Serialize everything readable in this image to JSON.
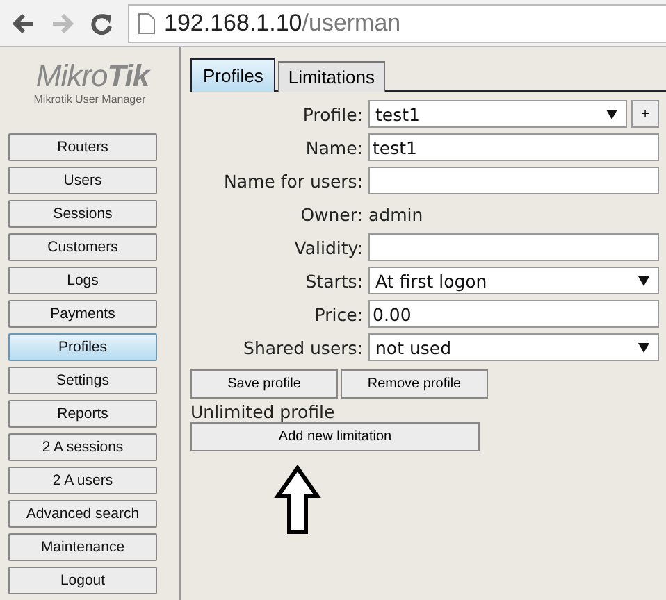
{
  "browser": {
    "url_host": "192.168.1.10",
    "url_path": "/userman"
  },
  "logo": {
    "brand_light": "Mikro",
    "brand_bold": "Tik",
    "subtitle": "Mikrotik User Manager"
  },
  "sidebar": {
    "items": [
      {
        "label": "Routers",
        "selected": false
      },
      {
        "label": "Users",
        "selected": false
      },
      {
        "label": "Sessions",
        "selected": false
      },
      {
        "label": "Customers",
        "selected": false
      },
      {
        "label": "Logs",
        "selected": false
      },
      {
        "label": "Payments",
        "selected": false
      },
      {
        "label": "Profiles",
        "selected": true
      },
      {
        "label": "Settings",
        "selected": false
      },
      {
        "label": "Reports",
        "selected": false
      },
      {
        "label": "2 A sessions",
        "selected": false
      },
      {
        "label": "2 A users",
        "selected": false
      },
      {
        "label": "Advanced search",
        "selected": false
      },
      {
        "label": "Maintenance",
        "selected": false
      },
      {
        "label": "Logout",
        "selected": false
      }
    ]
  },
  "tabs": [
    {
      "label": "Profiles",
      "selected": true
    },
    {
      "label": "Limitations",
      "selected": false
    }
  ],
  "form": [
    {
      "kind": "select",
      "label": "Profile:",
      "value": "test1",
      "add_button": "+"
    },
    {
      "kind": "input",
      "label": "Name:",
      "value": "test1"
    },
    {
      "kind": "input",
      "label": "Name for users:"
    },
    {
      "kind": "text",
      "label": "Owner:",
      "value": "admin"
    },
    {
      "kind": "input",
      "label": "Validity:"
    },
    {
      "kind": "select",
      "label": "Starts:",
      "value": "At first logon"
    },
    {
      "kind": "input",
      "label": "Price:",
      "value": "0.00"
    },
    {
      "kind": "select",
      "label": "Shared users:",
      "value": "not used"
    }
  ],
  "buttons": [
    "Save profile",
    "Remove profile"
  ],
  "limitations_heading": "Unlimited profile",
  "add_limitation_button": "Add new limitation"
}
